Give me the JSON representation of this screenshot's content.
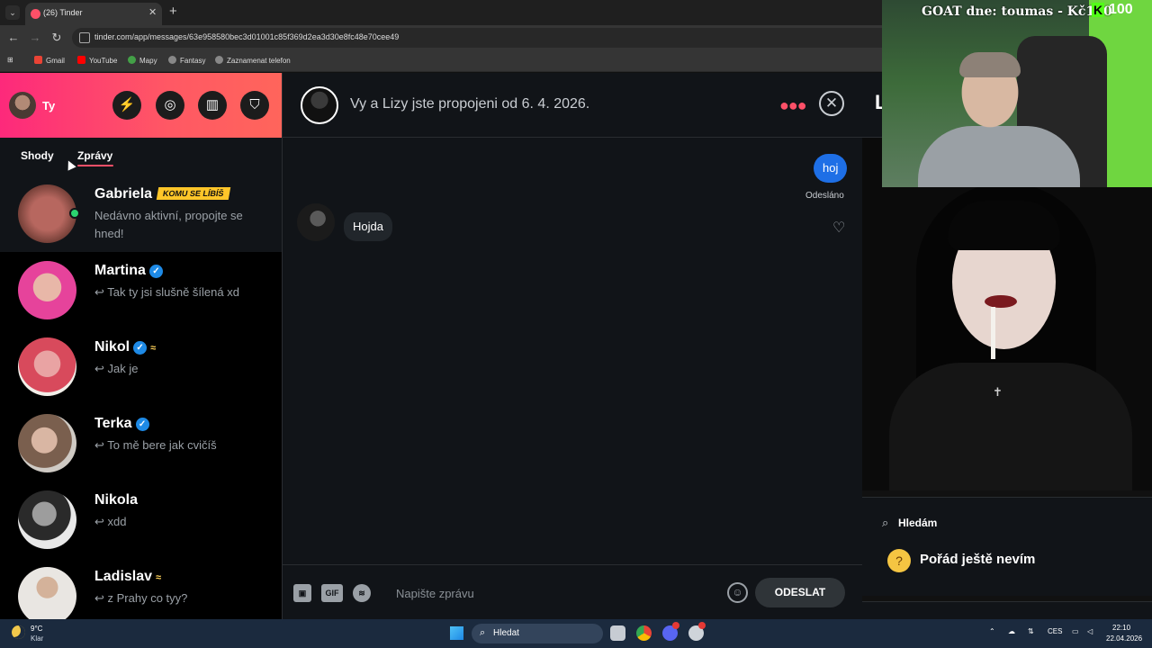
{
  "browser": {
    "tab_title": "(26) Tinder",
    "url": "tinder.com/app/messages/63e958580bec3d01001c85f369d2ea3d30e8fc48e70cee49",
    "bookmarks": [
      "Gmail",
      "YouTube",
      "Mapy",
      "Fantasy",
      "Zaznamenat telefon"
    ]
  },
  "left_panel": {
    "me_label": "Ty",
    "tabs": [
      "Shody",
      "Zprávy"
    ],
    "conversations": [
      {
        "name": "Gabriela",
        "badge": "KOMU SE LÍBÍŠ",
        "message": "Nedávno aktivní, propojte se hned!",
        "highlighted": true
      },
      {
        "name": "Martina",
        "message": "↩ Tak ty jsi slušně šílená xd",
        "verified": true
      },
      {
        "name": "Nikol",
        "message": "↩ Jak je",
        "verified": true
      },
      {
        "name": "Terka",
        "message": "↩ To mě bere jak cvičíš",
        "verified": true
      },
      {
        "name": "Nikola",
        "message": "↩ xdd"
      },
      {
        "name": "Ladislav",
        "message": "↩ z Prahy co tyy?"
      }
    ]
  },
  "chat": {
    "header_text": "Vy a Lizy jste propojeni od 6. 4. 2026.",
    "outgoing_message": "hoj",
    "sent_status": "Odesláno",
    "incoming_message": "Hojda",
    "composer_placeholder": "Napište zprávu",
    "gif_label": "GIF",
    "send_label": "ODESLAT"
  },
  "profile": {
    "looking_label": "Hledám",
    "looking_value": "Pořád ještě nevím"
  },
  "stream_overlay": {
    "goat_text": "GOAT dne: toumas - Kč100",
    "kick_letter": "K",
    "kick_count": "100"
  },
  "taskbar": {
    "temperature": "9°C",
    "condition": "Klar",
    "search_label": "Hledat",
    "language": "CES",
    "time": "22:10",
    "date": "22.04.2026"
  },
  "colors": {
    "tinder_gradient_start": "#fd297b",
    "tinder_gradient_end": "#ff655b",
    "outgoing_bubble": "#1e6fe6",
    "verified": "#1e8ae6",
    "badge": "#ffc629"
  }
}
